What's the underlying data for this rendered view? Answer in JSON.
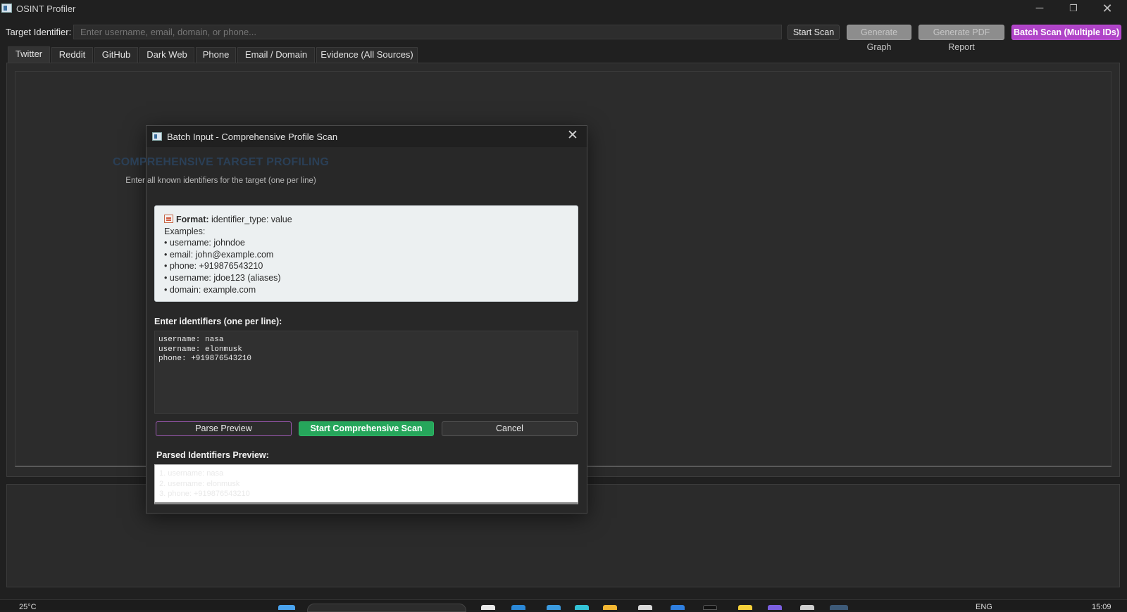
{
  "window": {
    "title": "OSINT Profiler",
    "controls": {
      "minimize": "─",
      "maximize": "❐",
      "close": "✕"
    }
  },
  "toolbar": {
    "target_label": "Target Identifier:",
    "target_placeholder": "Enter username, email, domain, or phone...",
    "start_scan": "Start Scan",
    "generate_graph": "Generate Graph",
    "generate_pdf": "Generate PDF Report",
    "batch_scan": "Batch Scan (Multiple IDs)"
  },
  "tabs": [
    {
      "label": "Twitter",
      "active": true
    },
    {
      "label": "Reddit"
    },
    {
      "label": "GitHub"
    },
    {
      "label": "Dark Web"
    },
    {
      "label": "Phone"
    },
    {
      "label": "Email / Domain"
    },
    {
      "label": "Evidence (All Sources)"
    }
  ],
  "dialog": {
    "title": "Batch Input - Comprehensive Profile Scan",
    "close_glyph": "✕",
    "heading": "COMPREHENSIVE TARGET PROFILING",
    "subheading": "Enter all known identifiers for the target (one per line)",
    "format_box": {
      "format_label": "Format:",
      "format_value": "identifier_type: value",
      "examples_label": "Examples:",
      "examples": [
        "• username: johndoe",
        "• email: john@example.com",
        "• phone: +919876543210",
        "• username: jdoe123 (aliases)",
        "• domain: example.com"
      ]
    },
    "identifiers_label": "Enter identifiers (one per line):",
    "identifiers_lines": [
      "username: nasa",
      "username: elonmusk",
      "phone: +919876543210"
    ],
    "buttons": {
      "parse_preview": "Parse  Preview",
      "start_comprehensive": "Start Comprehensive Scan",
      "cancel": "Cancel"
    },
    "preview_label": "Parsed Identifiers Preview:",
    "preview_lines": [
      "1. username: nasa",
      "2. username: elonmusk",
      "3. phone: +919876543210"
    ]
  },
  "taskbar": {
    "temperature": "25°C",
    "language": "ENG",
    "clock": "15:09"
  },
  "colors": {
    "accent_purple": "#b044c8",
    "accent_green": "#26a65b",
    "heading_blue": "#2a3f56",
    "background": "#202020"
  }
}
